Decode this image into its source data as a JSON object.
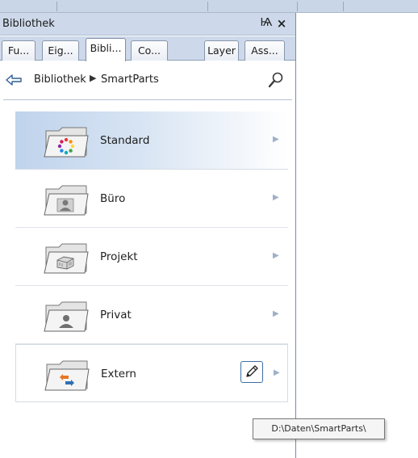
{
  "panel": {
    "title": "Bibliothek",
    "pin_glyph": "Ѩ",
    "close_glyph": "×"
  },
  "tabs": [
    {
      "label": "Fu...",
      "active": false
    },
    {
      "label": "Eig...",
      "active": false
    },
    {
      "label": "Bibli...",
      "active": true
    },
    {
      "label": "Co...",
      "active": false
    },
    {
      "label": "Layer",
      "active": false
    },
    {
      "label": "Ass...",
      "active": false
    }
  ],
  "breadcrumb": {
    "root": "Bibliothek",
    "separator": "▶",
    "current": "SmartParts"
  },
  "icons": {
    "back": "back-arrow-icon",
    "search": "search-magnifier-icon",
    "edit": "pencil-icon",
    "item_arrow": "chevron-right-icon"
  },
  "items": [
    {
      "label": "Standard",
      "icon": "folder-color-wheel-icon",
      "selected": true
    },
    {
      "label": "Büro",
      "icon": "folder-person-icon",
      "selected": false
    },
    {
      "label": "Projekt",
      "icon": "folder-building-icon",
      "selected": false
    },
    {
      "label": "Privat",
      "icon": "folder-user-icon",
      "selected": false
    },
    {
      "label": "Extern",
      "icon": "folder-transfer-icon",
      "selected": false
    }
  ],
  "tooltip": {
    "text": "D:\\Daten\\SmartParts\\"
  },
  "colors": {
    "titlebar": "#cdd9ea",
    "selected_row": "#bfd3ec",
    "accent_blue": "#3b6ea5"
  }
}
